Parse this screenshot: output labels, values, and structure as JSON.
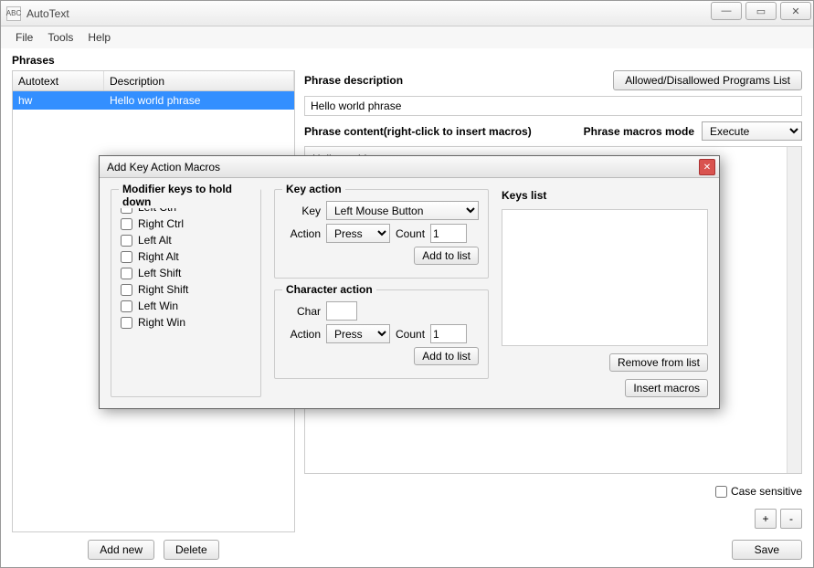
{
  "window": {
    "title": "AutoText",
    "app_icon_text": "ABC"
  },
  "menu": {
    "file": "File",
    "tools": "Tools",
    "help": "Help"
  },
  "phrases": {
    "label": "Phrases",
    "col_autotext": "Autotext",
    "col_description": "Description",
    "rows": [
      {
        "autotext": "hw",
        "description": "Hello world phrase"
      }
    ],
    "add_new": "Add new",
    "delete": "Delete"
  },
  "right": {
    "allowed_btn": "Allowed/Disallowed Programs List",
    "desc_label": "Phrase description",
    "desc_value": "Hello world phrase",
    "content_label": "Phrase content(right-click to insert macros)",
    "macros_mode_label": "Phrase macros mode",
    "macros_mode_value": "Execute",
    "content_value": "Hello world",
    "case_sensitive": "Case sensitive",
    "plus": "+",
    "minus": "-",
    "save": "Save"
  },
  "modal": {
    "title": "Add Key Action Macros",
    "modifier": {
      "title": "Modifier keys to hold down",
      "items": [
        "Left Ctrl",
        "Right Ctrl",
        "Left Alt",
        "Right Alt",
        "Left Shift",
        "Right Shift",
        "Left Win",
        "Right Win"
      ]
    },
    "key_action": {
      "title": "Key action",
      "key_label": "Key",
      "key_value": "Left Mouse Button",
      "action_label": "Action",
      "action_value": "Press",
      "count_label": "Count",
      "count_value": "1",
      "add": "Add to list"
    },
    "char_action": {
      "title": "Character action",
      "char_label": "Char",
      "char_value": "",
      "action_label": "Action",
      "action_value": "Press",
      "count_label": "Count",
      "count_value": "1",
      "add": "Add to list"
    },
    "keys_list": {
      "title": "Keys list",
      "remove": "Remove from list",
      "insert": "Insert macros"
    }
  }
}
